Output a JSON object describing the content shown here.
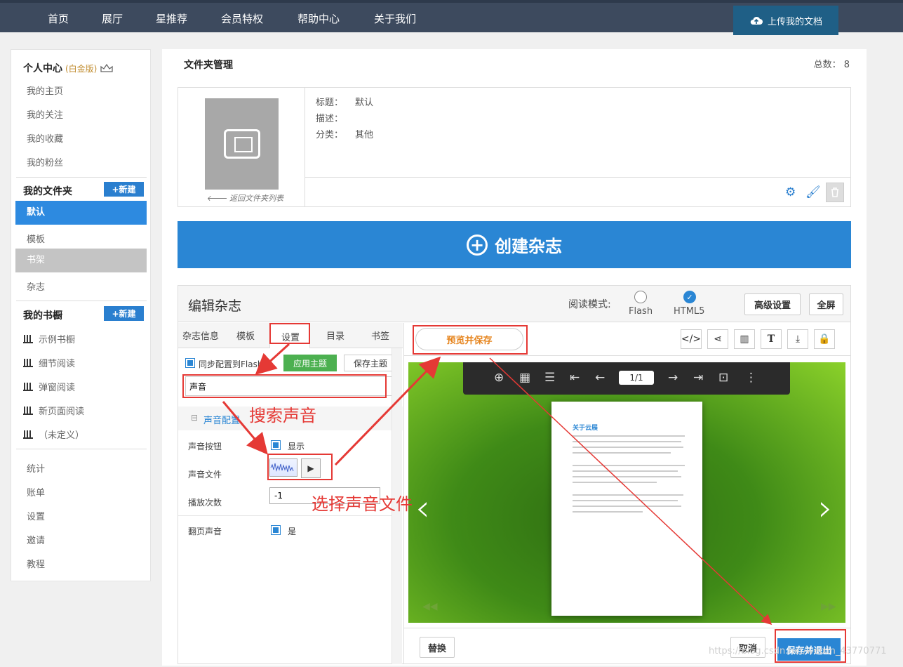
{
  "nav": {
    "items": [
      "首页",
      "展厅",
      "星推荐",
      "会员特权",
      "帮助中心",
      "关于我们"
    ],
    "upload": "上传我的文档"
  },
  "sidebar": {
    "personal_title": "个人中心",
    "personal_tag": "(白金版)",
    "personal_links": [
      "我的主页",
      "我的关注",
      "我的收藏",
      "我的粉丝"
    ],
    "folders_title": "我的文件夹",
    "new_label": "+新建",
    "folders": [
      "默认",
      "模板",
      "书架",
      "杂志"
    ],
    "shelves_title": "我的书橱",
    "shelves": [
      "示例书橱",
      "细节阅读",
      "弹窗阅读",
      "新页面阅读",
      "（未定义）"
    ],
    "bottom_links": [
      "统计",
      "账单",
      "设置",
      "邀请",
      "教程"
    ]
  },
  "folder": {
    "title": "文件夹管理",
    "total": "总数： 8",
    "back": "返回文件夹列表",
    "labels": [
      "标题：",
      "描述：",
      "分类："
    ],
    "values": [
      "默认",
      "",
      "其他"
    ]
  },
  "create_button": "创建杂志",
  "editor": {
    "title": "编辑杂志",
    "read_mode": "阅读模式:",
    "modes": [
      "Flash",
      "HTML5"
    ],
    "selected_mode": "HTML5",
    "advanced": "高级设置",
    "fullscreen": "全屏",
    "tabs": [
      "杂志信息",
      "模板",
      "设置",
      "目录",
      "书签"
    ],
    "active_tab": "设置",
    "sync_label": "同步配置到Flash",
    "apply_theme": "应用主题",
    "save_theme": "保存主题",
    "search_value": "声音",
    "section": "声音配置",
    "rows": {
      "sound_button": "声音按钮",
      "sound_button_value": "显示",
      "sound_file": "声音文件",
      "play_count": "播放次数",
      "play_count_value": "-1",
      "flip_sound": "翻页声音",
      "flip_sound_value": "是"
    },
    "preview_save": "预览并保存",
    "page_indicator": "1/1",
    "book_title": "关于云展",
    "replace": "替换",
    "cancel": "取消",
    "save_exit": "保存并退出"
  },
  "annotations": {
    "search_sound": "搜索声音",
    "choose_file": "选择声音文件",
    "color": "#e53935"
  },
  "watermark": "https://blog.csdn.net/weixin_43770771",
  "icons": [
    "cloud-upload-icon",
    "crown-icon",
    "folder-book-icon",
    "arrow-left-icon",
    "gear-icon",
    "brush-icon",
    "trash-icon",
    "plus-circle-icon",
    "code-icon",
    "share-icon",
    "book-icon",
    "text-icon",
    "download-icon",
    "lock-icon",
    "zoom-in-icon",
    "grid-icon",
    "list-icon",
    "first-page-icon",
    "prev-icon",
    "next-icon",
    "last-page-icon",
    "fit-icon",
    "more-icon",
    "play-icon"
  ]
}
